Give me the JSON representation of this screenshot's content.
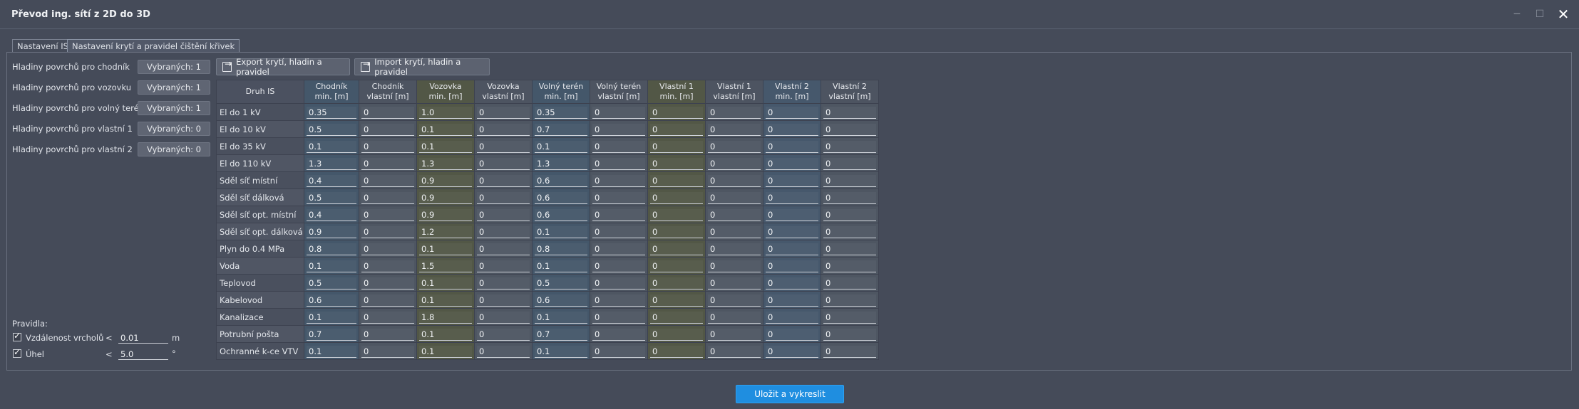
{
  "window": {
    "title": "Převod ing. sítí z 2D do 3D",
    "minimize_glyph": "─",
    "maximize_glyph": "☐",
    "close_glyph": "✕"
  },
  "tabs": [
    {
      "label": "Nastavení IS",
      "active": false
    },
    {
      "label": "Nastavení krytí a pravidel čištění křivek",
      "active": true
    }
  ],
  "surfaces": [
    {
      "label": "Hladiny povrchů pro chodník",
      "button": "Vybraných: 1"
    },
    {
      "label": "Hladiny povrchů pro vozovku",
      "button": "Vybraných: 1"
    },
    {
      "label": "Hladiny povrchů pro volný terén",
      "button": "Vybraných: 1"
    },
    {
      "label": "Hladiny povrchů pro vlastní 1",
      "button": "Vybraných: 0"
    },
    {
      "label": "Hladiny povrchů pro vlastní 2",
      "button": "Vybraných: 0"
    }
  ],
  "toolbar": {
    "export_label": "Export krytí, hladin a pravidel",
    "import_label": "Import krytí, hladin a pravidel"
  },
  "table": {
    "row_header": "Druh IS",
    "columns": [
      {
        "l1": "Chodník",
        "l2": "min. [m]"
      },
      {
        "l1": "Chodník",
        "l2": "vlastní [m]"
      },
      {
        "l1": "Vozovka",
        "l2": "min. [m]"
      },
      {
        "l1": "Vozovka",
        "l2": "vlastní [m]"
      },
      {
        "l1": "Volný terén",
        "l2": "min. [m]"
      },
      {
        "l1": "Volný terén",
        "l2": "vlastní [m]"
      },
      {
        "l1": "Vlastní 1",
        "l2": "min. [m]"
      },
      {
        "l1": "Vlastní 1",
        "l2": "vlastní [m]"
      },
      {
        "l1": "Vlastní 2",
        "l2": "min. [m]"
      },
      {
        "l1": "Vlastní 2",
        "l2": "vlastní [m]"
      }
    ],
    "rows": [
      {
        "name": "El do 1 kV",
        "values": [
          "0.35",
          "0",
          "1.0",
          "0",
          "0.35",
          "0",
          "0",
          "0",
          "0",
          "0"
        ]
      },
      {
        "name": "El do 10 kV",
        "values": [
          "0.5",
          "0",
          "0.1",
          "0",
          "0.7",
          "0",
          "0",
          "0",
          "0",
          "0"
        ]
      },
      {
        "name": "El do 35 kV",
        "values": [
          "0.1",
          "0",
          "0.1",
          "0",
          "0.1",
          "0",
          "0",
          "0",
          "0",
          "0"
        ]
      },
      {
        "name": "El do 110 kV",
        "values": [
          "1.3",
          "0",
          "1.3",
          "0",
          "1.3",
          "0",
          "0",
          "0",
          "0",
          "0"
        ]
      },
      {
        "name": "Sděl síť místní",
        "values": [
          "0.4",
          "0",
          "0.9",
          "0",
          "0.6",
          "0",
          "0",
          "0",
          "0",
          "0"
        ]
      },
      {
        "name": "Sděl síť dálková",
        "values": [
          "0.5",
          "0",
          "0.9",
          "0",
          "0.6",
          "0",
          "0",
          "0",
          "0",
          "0"
        ]
      },
      {
        "name": "Sděl síť opt. místní",
        "values": [
          "0.4",
          "0",
          "0.9",
          "0",
          "0.6",
          "0",
          "0",
          "0",
          "0",
          "0"
        ]
      },
      {
        "name": "Sděl síť opt. dálková",
        "values": [
          "0.9",
          "0",
          "1.2",
          "0",
          "0.1",
          "0",
          "0",
          "0",
          "0",
          "0"
        ]
      },
      {
        "name": "Plyn do 0.4 MPa",
        "values": [
          "0.8",
          "0",
          "0.1",
          "0",
          "0.8",
          "0",
          "0",
          "0",
          "0",
          "0"
        ]
      },
      {
        "name": "Voda",
        "values": [
          "0.1",
          "0",
          "1.5",
          "0",
          "0.1",
          "0",
          "0",
          "0",
          "0",
          "0"
        ]
      },
      {
        "name": "Teplovod",
        "values": [
          "0.5",
          "0",
          "0.1",
          "0",
          "0.5",
          "0",
          "0",
          "0",
          "0",
          "0"
        ]
      },
      {
        "name": "Kabelovod",
        "values": [
          "0.6",
          "0",
          "0.1",
          "0",
          "0.6",
          "0",
          "0",
          "0",
          "0",
          "0"
        ]
      },
      {
        "name": "Kanalizace",
        "values": [
          "0.1",
          "0",
          "1.8",
          "0",
          "0.1",
          "0",
          "0",
          "0",
          "0",
          "0"
        ]
      },
      {
        "name": "Potrubní pošta",
        "values": [
          "0.7",
          "0",
          "0.1",
          "0",
          "0.7",
          "0",
          "0",
          "0",
          "0",
          "0"
        ]
      },
      {
        "name": "Ochranné k-ce VTV",
        "values": [
          "0.1",
          "0",
          "0.1",
          "0",
          "0.1",
          "0",
          "0",
          "0",
          "0",
          "0"
        ]
      }
    ]
  },
  "rules": {
    "heading": "Pravidla:",
    "items": [
      {
        "label": "Vzdálenost vrcholů",
        "checked": true,
        "op": "<",
        "value": "0.01",
        "unit": "m"
      },
      {
        "label": "Úhel",
        "checked": true,
        "op": "<",
        "value": "5.0",
        "unit": "°"
      }
    ]
  },
  "footer": {
    "primary_label": "Uložit a vykreslit"
  },
  "colors": {
    "background": "#454b59",
    "primary": "#1f8ee0"
  }
}
